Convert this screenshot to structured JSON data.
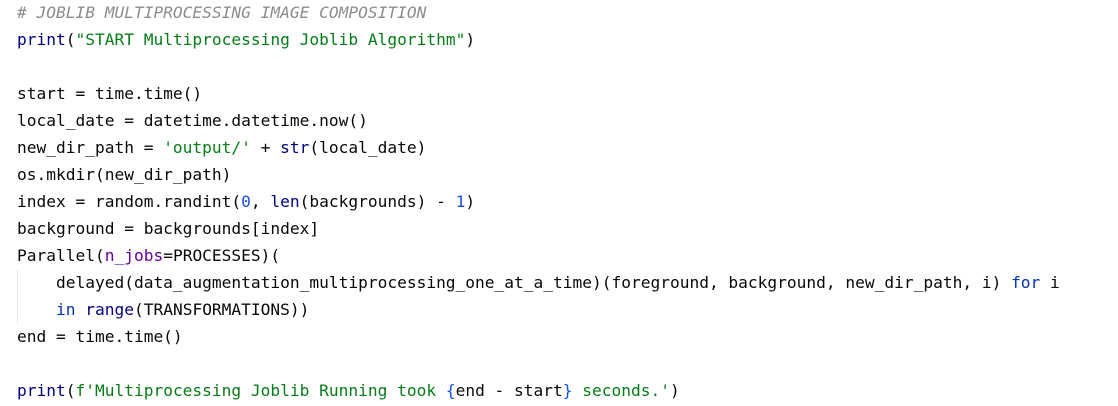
{
  "editor": {
    "lines": [
      {
        "tokens": [
          {
            "t": "# JOBLIB MULTIPROCESSING IMAGE COMPOSITION",
            "c": "comment"
          }
        ]
      },
      {
        "tokens": [
          {
            "t": "print",
            "c": "builtin"
          },
          {
            "t": "(",
            "c": "ident"
          },
          {
            "t": "\"START Multiprocessing Joblib Algorithm\"",
            "c": "string"
          },
          {
            "t": ")",
            "c": "ident"
          }
        ]
      },
      {
        "tokens": []
      },
      {
        "tokens": [
          {
            "t": "start = time.time()",
            "c": "ident"
          }
        ]
      },
      {
        "tokens": [
          {
            "t": "local_date = datetime.datetime.now()",
            "c": "ident"
          }
        ]
      },
      {
        "tokens": [
          {
            "t": "new_dir_path = ",
            "c": "ident"
          },
          {
            "t": "'output/'",
            "c": "string"
          },
          {
            "t": " + ",
            "c": "ident"
          },
          {
            "t": "str",
            "c": "builtin"
          },
          {
            "t": "(local_date)",
            "c": "ident"
          }
        ]
      },
      {
        "tokens": [
          {
            "t": "os.mkdir(new_dir_path)",
            "c": "ident"
          }
        ]
      },
      {
        "tokens": [
          {
            "t": "index = random.randint(",
            "c": "ident"
          },
          {
            "t": "0",
            "c": "number"
          },
          {
            "t": ", ",
            "c": "ident"
          },
          {
            "t": "len",
            "c": "builtin"
          },
          {
            "t": "(backgrounds) - ",
            "c": "ident"
          },
          {
            "t": "1",
            "c": "number"
          },
          {
            "t": ")",
            "c": "ident"
          }
        ]
      },
      {
        "tokens": [
          {
            "t": "background = backgrounds[index]",
            "c": "ident"
          }
        ]
      },
      {
        "tokens": [
          {
            "t": "Parallel(",
            "c": "ident"
          },
          {
            "t": "n_jobs",
            "c": "param"
          },
          {
            "t": "=PROCESSES)(",
            "c": "ident"
          }
        ]
      },
      {
        "tokens": [
          {
            "t": "    delayed(data_augmentation_multiprocessing_one_at_a_time)(foreground, background, new_dir_path, i) ",
            "c": "ident"
          },
          {
            "t": "for",
            "c": "keyword"
          },
          {
            "t": " i",
            "c": "ident"
          }
        ]
      },
      {
        "tokens": [
          {
            "t": "    ",
            "c": "ident"
          },
          {
            "t": "in",
            "c": "keyword"
          },
          {
            "t": " ",
            "c": "ident"
          },
          {
            "t": "range",
            "c": "builtin"
          },
          {
            "t": "(TRANSFORMATIONS))",
            "c": "ident"
          }
        ]
      },
      {
        "tokens": [
          {
            "t": "end = time.time()",
            "c": "ident"
          }
        ]
      },
      {
        "tokens": []
      },
      {
        "tokens": [
          {
            "t": "print",
            "c": "builtin"
          },
          {
            "t": "(",
            "c": "ident"
          },
          {
            "t": "f'Multiprocessing Joblib Running took ",
            "c": "string"
          },
          {
            "t": "{",
            "c": "number"
          },
          {
            "t": "end - start",
            "c": "ident"
          },
          {
            "t": "}",
            "c": "number"
          },
          {
            "t": " seconds.'",
            "c": "string"
          },
          {
            "t": ")",
            "c": "ident"
          }
        ]
      }
    ]
  }
}
